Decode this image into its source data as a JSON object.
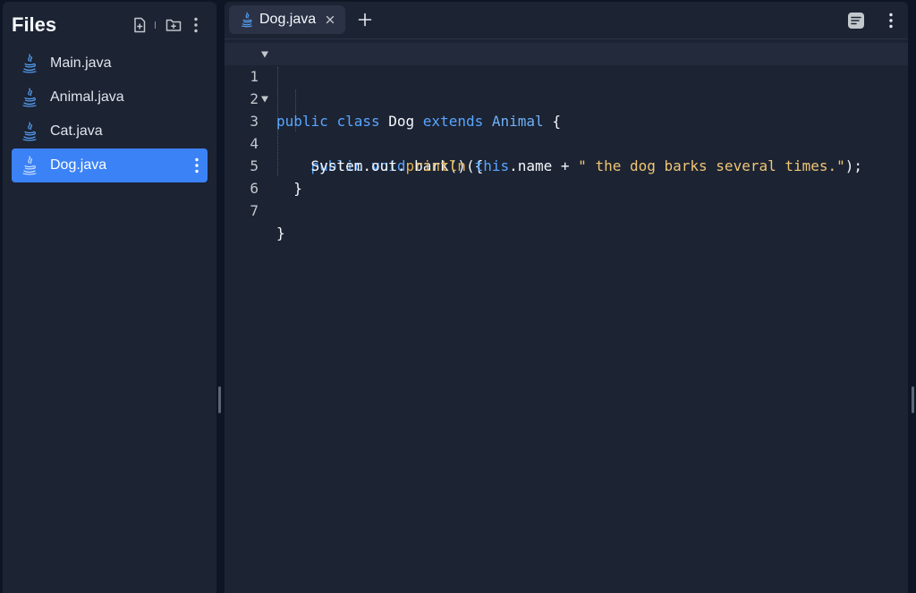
{
  "sidebar": {
    "title": "Files",
    "files": [
      {
        "label": "Main.java",
        "active": false
      },
      {
        "label": "Animal.java",
        "active": false
      },
      {
        "label": "Cat.java",
        "active": false
      },
      {
        "label": "Dog.java",
        "active": true
      }
    ]
  },
  "editor": {
    "tabs": [
      {
        "label": "Dog.java",
        "active": true
      }
    ],
    "lines": [
      {
        "num": "1"
      },
      {
        "num": "2"
      },
      {
        "num": "3"
      },
      {
        "num": "4"
      },
      {
        "num": "5"
      },
      {
        "num": "6"
      },
      {
        "num": "7"
      }
    ],
    "code": {
      "l1": {
        "kw1": "public",
        "kw2": "class",
        "name": "Dog",
        "kw3": "extends",
        "super": "Animal",
        "brace": "{"
      },
      "l3": {
        "kw1": "public",
        "kw2": "void",
        "method": "bark",
        "rest": "() {"
      },
      "l4": {
        "obj": "System.out.",
        "call": "println",
        "open": "(",
        "kw": "this",
        "field": ".name + ",
        "str": "\" the dog barks several times.\"",
        "close": ");"
      },
      "l5": {
        "brace": "}"
      },
      "l7": {
        "brace": "}"
      }
    }
  },
  "colors": {
    "background": "#0e1525",
    "panel": "#1c2333",
    "accent": "#3b82f6",
    "keyword": "#58a6ff",
    "string": "#f0c674"
  }
}
